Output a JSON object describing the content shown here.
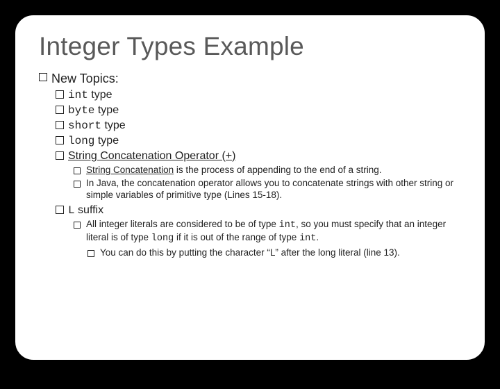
{
  "title": "Integer Types Example",
  "new_topics_label": "New Topics:",
  "int_label": "int",
  "byte_label": "byte",
  "short_label": "short",
  "long_label": "long",
  "type_word": " type",
  "concat_header": "String Concatenation Operator (+)",
  "concat_strong": "String Concatenation",
  "concat_rest": " is the process of appending to the end of a string.",
  "java_concat": "In Java, the concatenation operator allows you to concatenate strings with other string or simple variables of primitive type (Lines 15-18).",
  "L_label": "L",
  "suffix_word": " suffix",
  "suffix_pre": "All integer literals are considered to be of type ",
  "suffix_int": "int",
  "suffix_mid": ", so you must specify that an integer literal is of type ",
  "suffix_long": "long",
  "suffix_post": " if it is out of the range of type ",
  "suffix_int2": "int",
  "suffix_end": ".",
  "do_this": "You can do this by putting the character “L” after the long literal (line 13)."
}
